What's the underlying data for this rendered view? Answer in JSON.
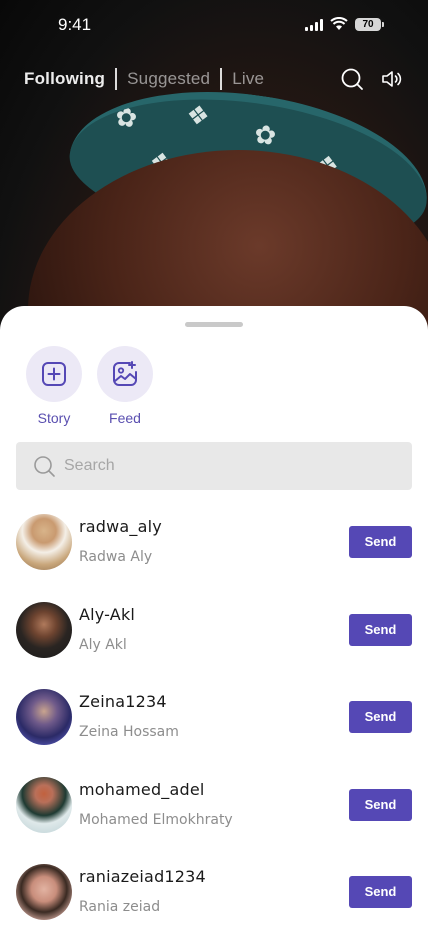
{
  "status_bar": {
    "time": "9:41",
    "battery": "70"
  },
  "top_nav": {
    "tabs": [
      {
        "label": "Following",
        "active": true
      },
      {
        "label": "Suggested",
        "active": false
      },
      {
        "label": "Live",
        "active": false
      }
    ],
    "icons": [
      "search-icon",
      "speaker-icon"
    ]
  },
  "share_sheet": {
    "options": [
      {
        "label": "Story",
        "icon": "add-story-icon"
      },
      {
        "label": "Feed",
        "icon": "feed-image-icon"
      }
    ],
    "search": {
      "placeholder": "Search",
      "value": ""
    },
    "contacts": [
      {
        "username": "radwa_aly",
        "name": "Radwa Aly",
        "action": "Send"
      },
      {
        "username": "Aly-Akl",
        "name": "Aly Akl",
        "action": "Send"
      },
      {
        "username": "Zeina1234",
        "name": "Zeina Hossam",
        "action": "Send"
      },
      {
        "username": "mohamed_adel",
        "name": "Mohamed Elmokhraty",
        "action": "Send"
      },
      {
        "username": "raniazeiad1234",
        "name": "Rania  zeiad",
        "action": "Send"
      }
    ]
  },
  "colors": {
    "accent": "#5548b5",
    "accent_light": "#ece9f6",
    "search_bg": "#e8e8e8"
  }
}
